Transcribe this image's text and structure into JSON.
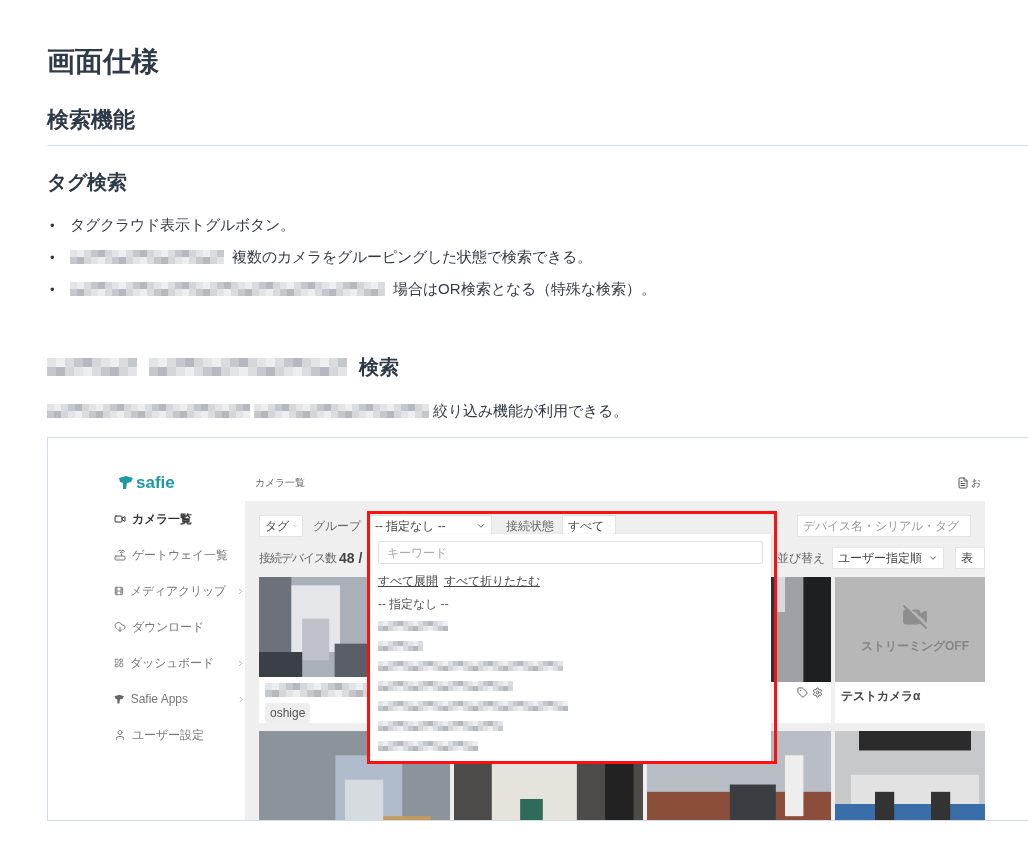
{
  "title": "画面仕様",
  "section": "検索機能",
  "tag_search": {
    "heading": "タグ検索",
    "bullets": [
      {
        "marker": "•",
        "segments": [
          {
            "kind": "text",
            "text": "タグクラウド表示トグルボタン。"
          }
        ]
      },
      {
        "marker": "•",
        "segments": [
          {
            "kind": "redacted"
          },
          {
            "kind": "text",
            "text": "複数のカメラをグルーピングした状態で検索できる。"
          }
        ]
      },
      {
        "marker": "•",
        "segments": [
          {
            "kind": "redacted"
          },
          {
            "kind": "text",
            "text": "場合はOR検索となる（特殊な検索）。"
          }
        ]
      }
    ]
  },
  "group_search": {
    "heading": [
      {
        "kind": "redacted"
      },
      {
        "kind": "redacted"
      },
      {
        "kind": "text",
        "text": "検索"
      }
    ],
    "paragraph": [
      {
        "kind": "redacted"
      },
      {
        "kind": "redacted"
      },
      {
        "kind": "text",
        "text": "絞り込み機能が利用できる。"
      }
    ]
  },
  "screenshot": {
    "logo": "safie",
    "page_title": "カメラ一覧",
    "notice": "お",
    "sidebar": [
      {
        "label": "カメラ一覧",
        "selected": true,
        "submenu": false
      },
      {
        "label": "ゲートウェイ一覧",
        "selected": false,
        "submenu": false
      },
      {
        "label": "メディアクリップ",
        "selected": false,
        "submenu": true
      },
      {
        "label": "ダウンロード",
        "selected": false,
        "submenu": false
      },
      {
        "label": "ダッシュボード",
        "selected": false,
        "submenu": true
      },
      {
        "label": "Safie Apps",
        "selected": false,
        "submenu": true
      },
      {
        "label": "ユーザー設定",
        "selected": false,
        "submenu": false
      }
    ],
    "filters": {
      "tag_button": "タグ",
      "group_label": "グループ",
      "group_select": "-- 指定なし --",
      "status_label": "接続状態",
      "status_select": "すべて",
      "search_placeholder": "デバイス名・シリアル・タグ"
    },
    "count_label": "接続デバイス数",
    "count": "48 /",
    "sort_label": "並び替え",
    "sort_select": "ユーザー指定順",
    "view_select": "表",
    "cameras": [
      [
        {
          "kind": "picture",
          "caption": {
            "kind": "redacted"
          },
          "tag": "oshige",
          "actions": false
        },
        {
          "kind": "picture",
          "actions": true
        },
        {
          "kind": "streaming_off",
          "status": "ストリーミングOFF",
          "caption": {
            "kind": "text",
            "text": "テストカメラα"
          },
          "actions": false
        }
      ],
      [
        {
          "kind": "picture",
          "actions": false
        },
        {
          "kind": "picture",
          "actions": false
        },
        {
          "kind": "picture",
          "actions": false
        },
        {
          "kind": "picture",
          "actions": false
        }
      ]
    ],
    "group_dropdown": {
      "placeholder": "キーワード",
      "links": [
        "すべて展開",
        "すべて折りたたむ"
      ],
      "options": [
        {
          "kind": "text",
          "label": "-- 指定なし --"
        },
        {
          "kind": "redacted"
        },
        {
          "kind": "redacted"
        },
        {
          "kind": "redacted"
        },
        {
          "kind": "redacted"
        },
        {
          "kind": "redacted"
        },
        {
          "kind": "redacted"
        },
        {
          "kind": "redacted"
        }
      ]
    }
  }
}
